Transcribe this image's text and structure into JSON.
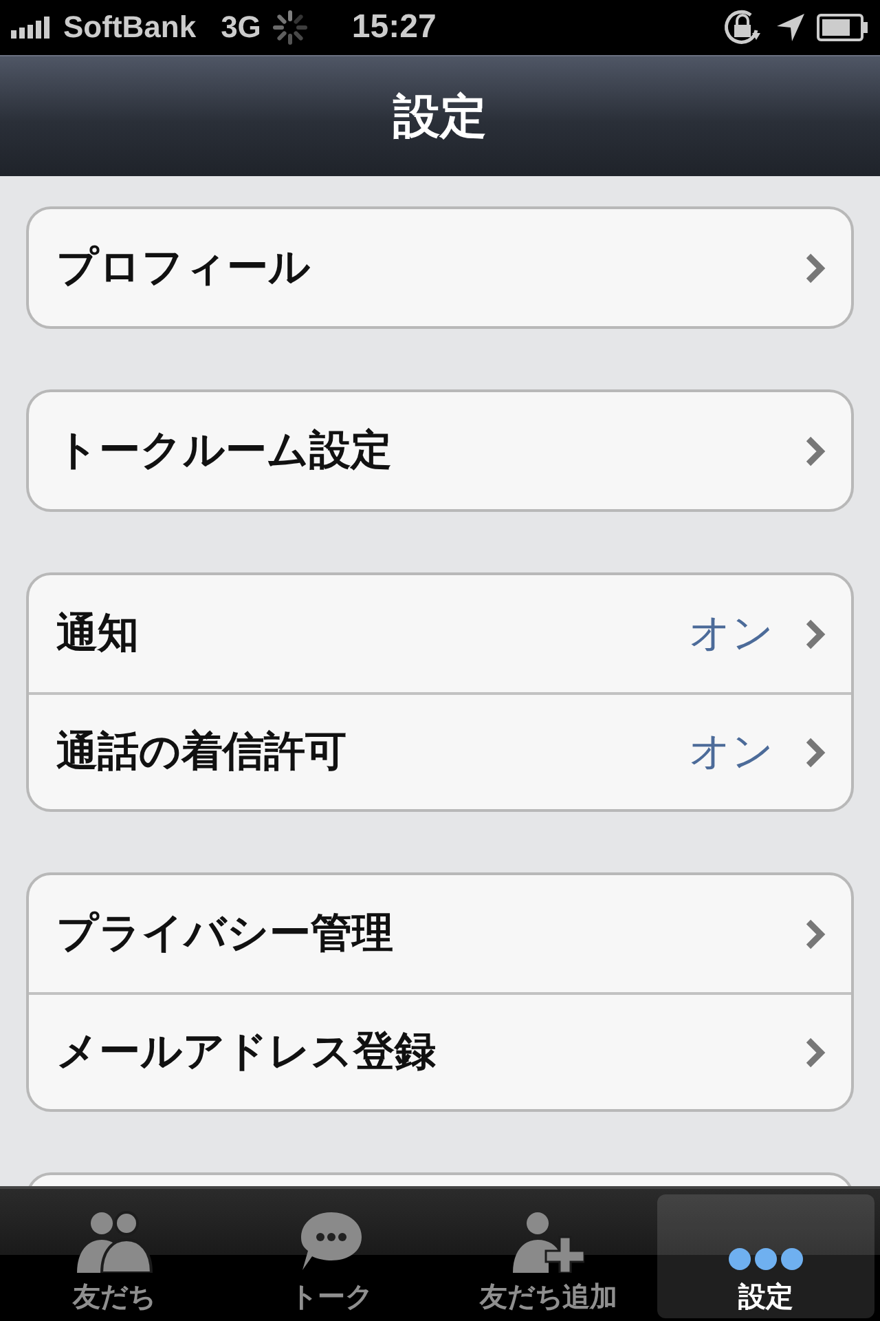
{
  "status_bar": {
    "carrier": "SoftBank",
    "network": "3G",
    "time": "15:27"
  },
  "nav_bar": {
    "title": "設定"
  },
  "groups": [
    {
      "rows": [
        {
          "label": "プロフィール"
        }
      ]
    },
    {
      "rows": [
        {
          "label": "トークルーム設定"
        }
      ]
    },
    {
      "rows": [
        {
          "label": "通知",
          "value": "オン"
        },
        {
          "label": "通話の着信許可",
          "value": "オン"
        }
      ]
    },
    {
      "rows": [
        {
          "label": "プライバシー管理"
        },
        {
          "label": "メールアドレス登録"
        }
      ]
    }
  ],
  "tab_bar": [
    {
      "label": "友だち",
      "kind": "friends",
      "selected": false
    },
    {
      "label": "トーク",
      "kind": "talk",
      "selected": false
    },
    {
      "label": "友だち追加",
      "kind": "add",
      "selected": false
    },
    {
      "label": "設定",
      "kind": "more",
      "selected": true
    }
  ]
}
